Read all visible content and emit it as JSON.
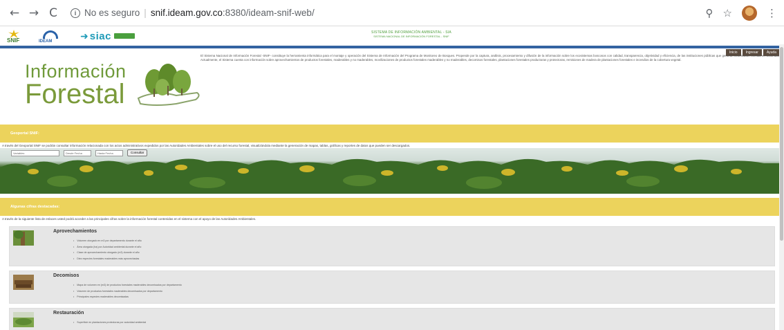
{
  "browser": {
    "back_icon": "←",
    "forward_icon": "→",
    "reload_icon": "C",
    "info_icon": "i",
    "not_secure": "No es seguro",
    "separator": "|",
    "url_host": "snif.ideam.gov.co",
    "url_path": ":8380/ideam-snif-web/",
    "zoom_icon": "⚲",
    "star_icon": "☆",
    "menu_icon": "⋮"
  },
  "header": {
    "snif_logo_text": "SNIF",
    "ideam_logo_text": "IDEAM",
    "siac_logo_text": "siac",
    "center_line1": "SISTEMA DE INFORMACIÓN AMBIENTAL - SIA",
    "center_line2": "SISTEMA NACIONAL DE INFORMACIÓN FORESTAL - SNIF"
  },
  "top_nav": [
    "Inicio",
    "Ingresar",
    "Ayuda"
  ],
  "hero": {
    "title_line1": "Información",
    "title_line2": "Forestal",
    "intro": "El Sistema Nacional de Información Forestal -SNIF- constituye la herramienta informática para el montaje y operación del Sistema de Información del Programa de Monitoreo de Bosques. Propende por la captura, análisis, procesamiento y difusión de la información sobre los ecosistemas boscosos con calidad, transparencia, objetividad y eficiencia, de las instituciones públicas que generan información forestal en Colombia. Actualmente, el Sistema cuenta con información sobre aprovechamientos de productos forestales, maderables y no maderables, movilizaciones de productos forestales maderables y no maderables, decomisos forestales, plantaciones forestales productoras y protectoras, remisiones de madera de plantaciones forestales e incendios de la cobertura vegetal."
  },
  "geoportal": {
    "banner": "Geoportal SNIF:",
    "description": "A través del Geoportal SNIF se podrán consultar información relacionada con los actos administrativos expedidos por las Autoridades Ambientales sobre el uso del recurso forestal, visualizándola mediante la generación de mapas, tablas, gráficas y reportes de datos que pueden ser descargados.",
    "field1_placeholder": "Variables",
    "field2_placeholder": "Desde Fecha",
    "field3_placeholder": "Hasta Fecha",
    "consult_button": "Consultar"
  },
  "figures": {
    "banner": "Algunas cifras destacadas:",
    "description": "A través de la siguiente lista de enlaces usted podrá acceder a las principales cifras sobre la información forestal contenidas en el sistema con el apoyo de las Autoridades Ambientales."
  },
  "cards": [
    {
      "title": "Aprovechamientos",
      "items": [
        "Volumen otorgado en m3 por departamento durante el año",
        "Área otorgada (ha) por Autoridad ambiental durante el año",
        "Clase de aprovechamiento otorgado (m3) durante el año",
        "Diez especies forestales maderables más aprovechadas"
      ]
    },
    {
      "title": "Decomisos",
      "items": [
        "Mapa de volumen en (m3) de productos forestales maderables decomisados por departamento",
        "Volumen de productos forestales maderables decomisados por departamento",
        "Principales especies maderables decomisadas"
      ]
    },
    {
      "title": "Restauración",
      "items": [
        "Superficie en plantaciones protectoras por autoridad ambiental"
      ]
    }
  ],
  "colors": {
    "banner_yellow": "#ecd35c",
    "header_blue": "#3363a1",
    "title_green": "#6f9a3a"
  }
}
